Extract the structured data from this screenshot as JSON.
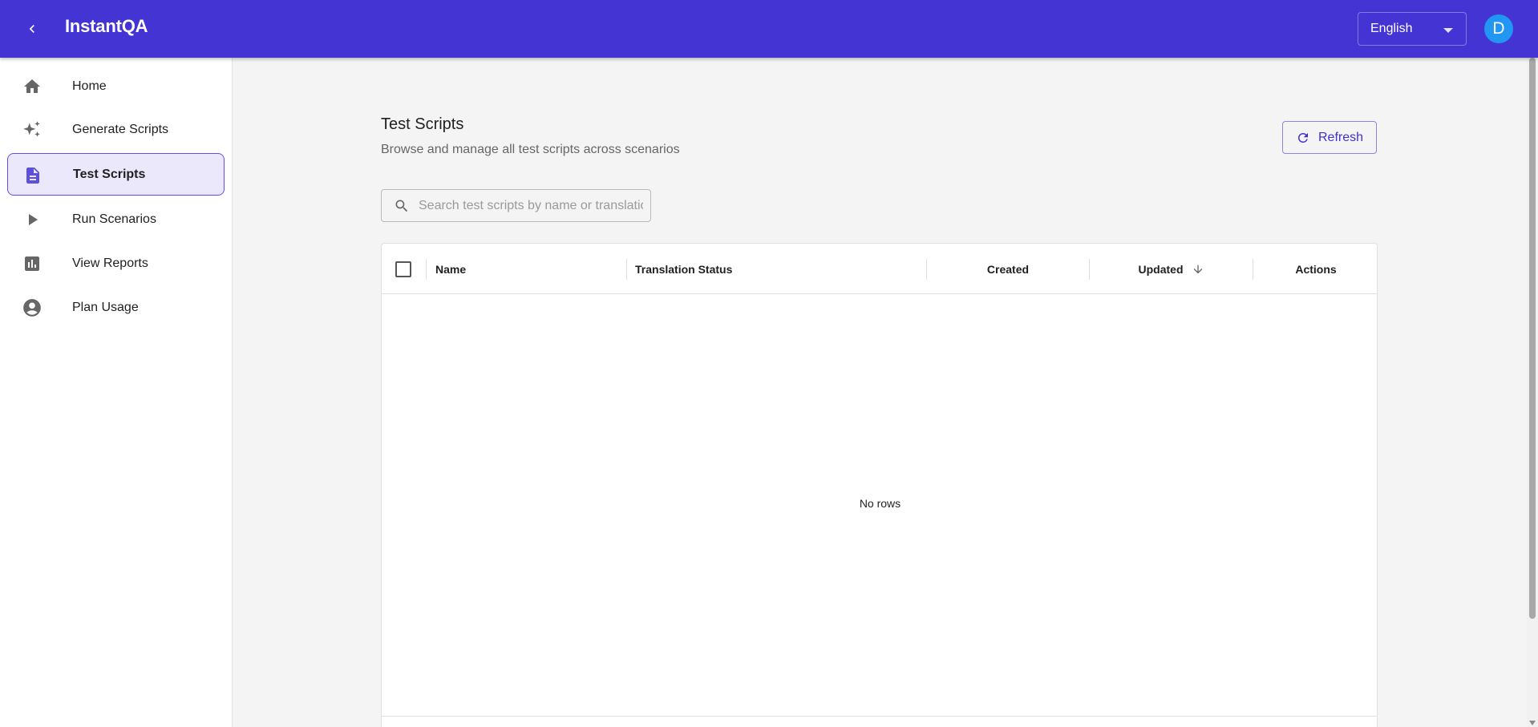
{
  "app": {
    "title": "InstantQA",
    "accent_color": "#4434d4",
    "back_icon": "chevron-left-icon"
  },
  "header": {
    "language": "English",
    "avatar_initial": "D"
  },
  "sidebar": {
    "items": [
      {
        "label": "Home",
        "icon": "home-icon",
        "active": false
      },
      {
        "label": "Generate Scripts",
        "icon": "sparkle-icon",
        "active": false
      },
      {
        "label": "Test Scripts",
        "icon": "document-icon",
        "active": true
      },
      {
        "label": "Run Scenarios",
        "icon": "play-icon",
        "active": false
      },
      {
        "label": "View Reports",
        "icon": "bar-chart-icon",
        "active": false
      },
      {
        "label": "Plan Usage",
        "icon": "account-circle-icon",
        "active": false
      }
    ]
  },
  "main": {
    "title": "Test Scripts",
    "subtitle": "Browse and manage all test scripts across scenarios",
    "refresh_label": "Refresh",
    "search_placeholder": "Search test scripts by name or translation",
    "table": {
      "columns": [
        "Name",
        "Translation Status",
        "Created",
        "Updated",
        "Actions"
      ],
      "sorted_column": "Updated",
      "sort_direction": "descending",
      "rows": [],
      "empty_text": "No rows"
    }
  }
}
